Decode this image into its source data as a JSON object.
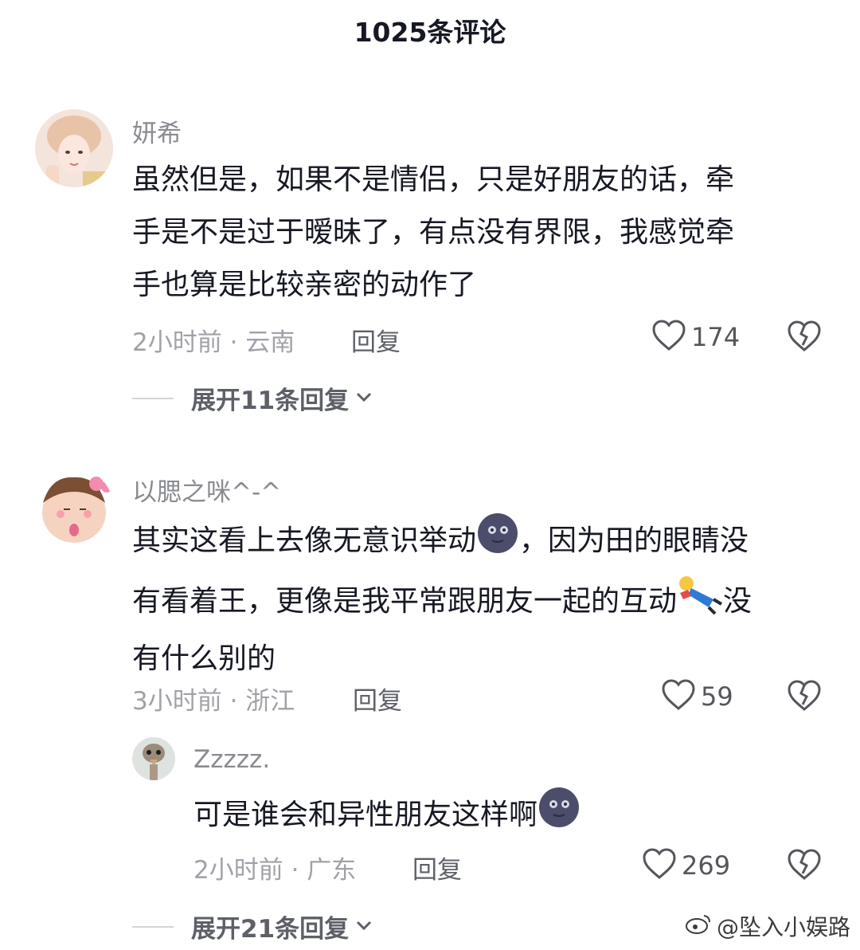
{
  "header": {
    "title": "1025条评论"
  },
  "comments": [
    {
      "username": "妍希",
      "text": "虽然但是，如果不是情侣，只是好朋友的话，牵手是不是过于暧昧了，有点没有界限，我感觉牵手也算是比较亲密的动作了",
      "lines": [
        "虽然但是，如果不是情侣，只是好朋友的话，牵",
        "手是不是过于暧昧了，有点没有界限，我感觉牵",
        "手也算是比较亲密的动作了"
      ],
      "time_location": "2小时前 · 云南",
      "reply_label": "回复",
      "likes": "174",
      "expand_label": "展开11条回复"
    },
    {
      "username": "以腮之咪^-^",
      "lines_seg": {
        "l1a": "其实这看上去像无意识举动",
        "l1b": "，因为田的眼睛没",
        "l2a": "有看着王，更像是我平常跟朋友一起的互动",
        "l2b": "没",
        "l3": "有什么别的"
      },
      "time_location": "3小时前 · 浙江",
      "reply_label": "回复",
      "likes": "59",
      "replies": [
        {
          "username": "Zzzzz.",
          "text": "可是谁会和异性朋友这样啊",
          "time_location": "2小时前 · 广东",
          "reply_label": "回复",
          "likes": "269"
        }
      ],
      "expand_label": "展开21条回复"
    }
  ],
  "watermark": {
    "text": "@坠入小娱路"
  },
  "icons": {
    "like": "heart-outline-icon",
    "dislike": "broken-heart-icon",
    "expand": "chevron-down-icon",
    "emoji": "moon-face-emoji"
  }
}
